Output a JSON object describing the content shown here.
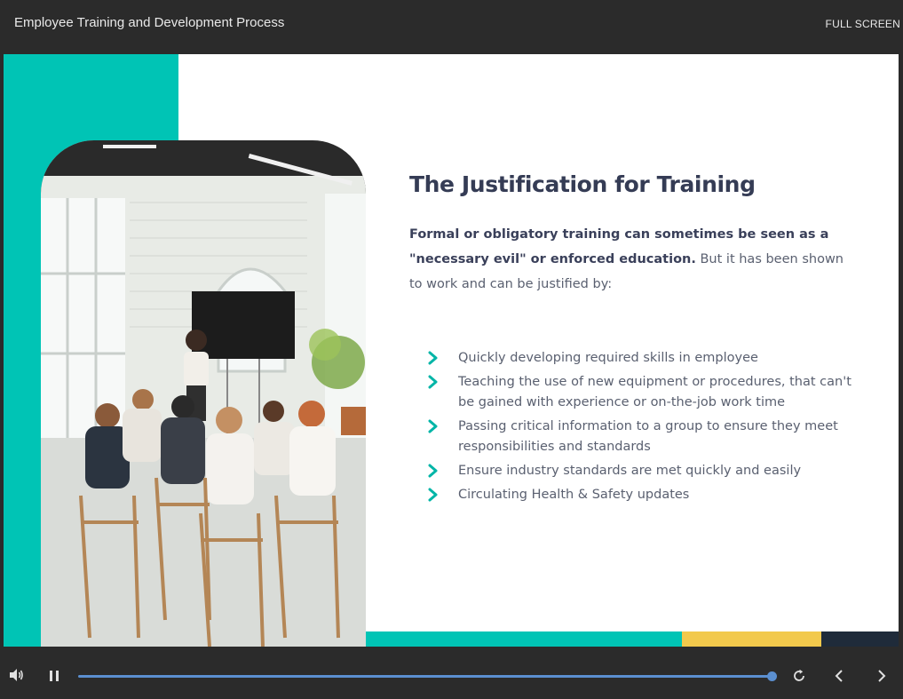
{
  "header": {
    "title": "Employee Training and Development Process",
    "fullscreen_label": "FULL SCREEN"
  },
  "slide": {
    "heading": "The Justification for Training",
    "intro_bold": "Formal or obligatory training can sometimes be seen as a \"necessary evil\" or enforced education.",
    "intro_rest": " But it has been shown to work and can be justified by:",
    "bullets": [
      "Quickly developing required skills in employee",
      "Teaching the use of new equipment or procedures, that can't be gained with experience or on-the-job work time",
      "Passing critical information to a group to ensure they meet responsibilities and standards",
      "Ensure industry standards are met quickly and easily",
      "Circulating Health & Safety updates"
    ]
  },
  "controls": {
    "progress": 1.0
  },
  "colors": {
    "accent_teal": "#00c4b5",
    "accent_yellow": "#f2c94c",
    "accent_navy": "#1f2b3a",
    "heading_text": "#353c55",
    "progress_blue": "#5b8fd0"
  },
  "icons": {
    "volume": "volume-icon",
    "pause": "pause-icon",
    "replay": "replay-icon",
    "previous": "chevron-left-icon",
    "next": "chevron-right-icon",
    "bullet": "chevron-right-icon"
  }
}
